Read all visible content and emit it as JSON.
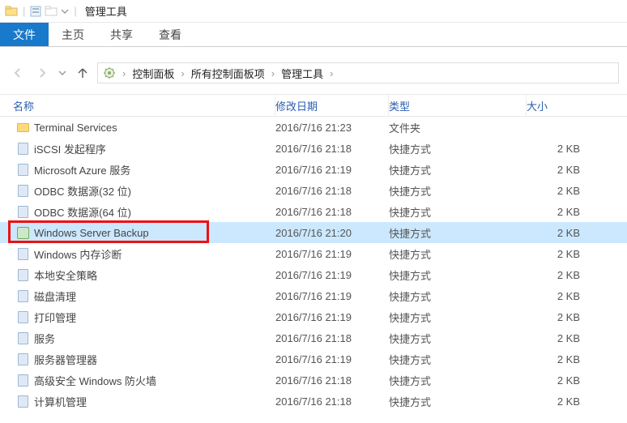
{
  "titlebar": {
    "title": "管理工具"
  },
  "tabs": [
    {
      "label": "文件",
      "active": true
    },
    {
      "label": "主页",
      "active": false
    },
    {
      "label": "共享",
      "active": false
    },
    {
      "label": "查看",
      "active": false
    }
  ],
  "breadcrumb": {
    "items": [
      "控制面板",
      "所有控制面板项",
      "管理工具"
    ]
  },
  "columns": {
    "name": "名称",
    "date": "修改日期",
    "type": "类型",
    "size": "大小"
  },
  "rows": [
    {
      "icon": "folder",
      "name": "Terminal Services",
      "date": "2016/7/16 21:23",
      "type": "文件夹",
      "size": ""
    },
    {
      "icon": "gen",
      "name": "iSCSI 发起程序",
      "date": "2016/7/16 21:18",
      "type": "快捷方式",
      "size": "2 KB"
    },
    {
      "icon": "gen",
      "name": "Microsoft Azure 服务",
      "date": "2016/7/16 21:19",
      "type": "快捷方式",
      "size": "2 KB"
    },
    {
      "icon": "gen",
      "name": "ODBC 数据源(32 位)",
      "date": "2016/7/16 21:18",
      "type": "快捷方式",
      "size": "2 KB"
    },
    {
      "icon": "gen",
      "name": "ODBC 数据源(64 位)",
      "date": "2016/7/16 21:18",
      "type": "快捷方式",
      "size": "2 KB"
    },
    {
      "icon": "backup",
      "name": "Windows Server Backup",
      "date": "2016/7/16 21:20",
      "type": "快捷方式",
      "size": "2 KB",
      "selected": true,
      "highlighted": true
    },
    {
      "icon": "gen",
      "name": "Windows 内存诊断",
      "date": "2016/7/16 21:19",
      "type": "快捷方式",
      "size": "2 KB"
    },
    {
      "icon": "gen",
      "name": "本地安全策略",
      "date": "2016/7/16 21:19",
      "type": "快捷方式",
      "size": "2 KB"
    },
    {
      "icon": "gen",
      "name": "磁盘清理",
      "date": "2016/7/16 21:19",
      "type": "快捷方式",
      "size": "2 KB"
    },
    {
      "icon": "gen",
      "name": "打印管理",
      "date": "2016/7/16 21:19",
      "type": "快捷方式",
      "size": "2 KB"
    },
    {
      "icon": "gen",
      "name": "服务",
      "date": "2016/7/16 21:18",
      "type": "快捷方式",
      "size": "2 KB"
    },
    {
      "icon": "gen",
      "name": "服务器管理器",
      "date": "2016/7/16 21:19",
      "type": "快捷方式",
      "size": "2 KB"
    },
    {
      "icon": "gen",
      "name": "高级安全 Windows 防火墙",
      "date": "2016/7/16 21:18",
      "type": "快捷方式",
      "size": "2 KB"
    },
    {
      "icon": "gen",
      "name": "计算机管理",
      "date": "2016/7/16 21:18",
      "type": "快捷方式",
      "size": "2 KB"
    }
  ]
}
